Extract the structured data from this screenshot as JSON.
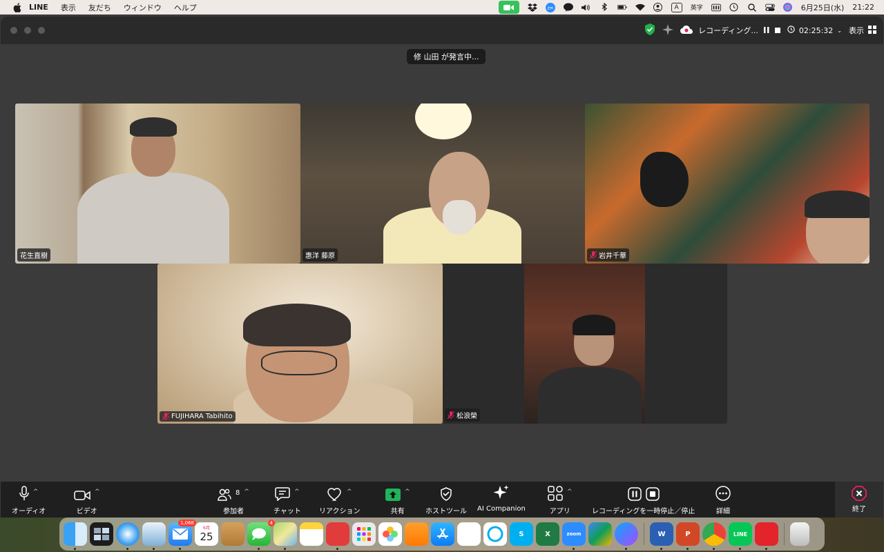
{
  "menubar": {
    "app_name": "LINE",
    "menus": [
      "表示",
      "友だち",
      "ウィンドウ",
      "ヘルプ"
    ],
    "input_mode": "A",
    "input_label": "英字",
    "date": "6月25日(水)",
    "time": "21:22"
  },
  "titlebar": {
    "recording_label": "レコーディング...",
    "elapsed": "02:25:32",
    "view_label": "表示"
  },
  "speaking": "修 山田 が発言中...",
  "participants": [
    {
      "name": "花生直樹",
      "muted": false
    },
    {
      "name": "惠洋 藤原",
      "muted": false
    },
    {
      "name": "岩井千華",
      "muted": true
    },
    {
      "name": "FUJIHARA Tabihito",
      "muted": true
    },
    {
      "name": "松浪榮",
      "muted": true
    }
  ],
  "toolbar": {
    "audio": "オーディオ",
    "video": "ビデオ",
    "participants": "参加者",
    "participant_count": "8",
    "chat": "チャット",
    "reactions": "リアクション",
    "share": "共有",
    "host_tools": "ホストツール",
    "ai_companion": "AI Companion",
    "apps": "アプリ",
    "recording": "レコーディングを一時停止／停止",
    "more": "詳細",
    "end": "終了"
  },
  "dock": {
    "mail_badge": "1,068",
    "calendar_month": "6月",
    "calendar_day": "25",
    "messages_badge": "4"
  },
  "colors": {
    "zoom_green": "#36c25b",
    "share_green": "#1fb35a",
    "end_red": "#e0245e",
    "toolbar_bg": "#1f1f1f"
  }
}
